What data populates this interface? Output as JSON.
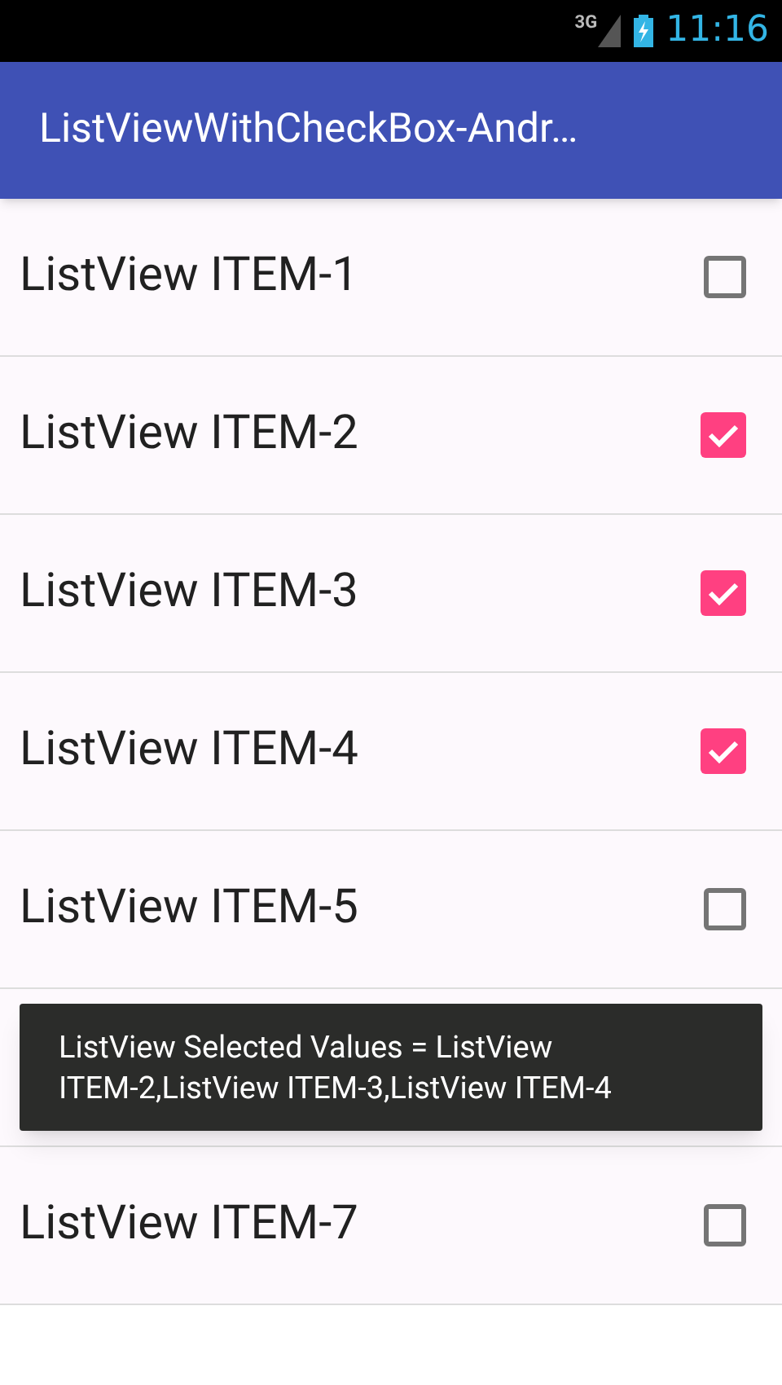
{
  "status_bar": {
    "network": "3G",
    "time": "11:16"
  },
  "app_bar": {
    "title": "ListViewWithCheckBox-Andr…"
  },
  "list": [
    {
      "kind": "row",
      "label": "ListView ITEM-1",
      "checked": false
    },
    {
      "kind": "row",
      "label": "ListView ITEM-2",
      "checked": true
    },
    {
      "kind": "row",
      "label": "ListView ITEM-3",
      "checked": true
    },
    {
      "kind": "row",
      "label": "ListView ITEM-4",
      "checked": true
    },
    {
      "kind": "row",
      "label": "ListView ITEM-5",
      "checked": false
    },
    {
      "kind": "toast",
      "message": "ListView Selected Values = ListView ITEM-2,ListView ITEM-3,ListView ITEM-4"
    },
    {
      "kind": "row",
      "label": "ListView ITEM-7",
      "checked": false
    }
  ]
}
